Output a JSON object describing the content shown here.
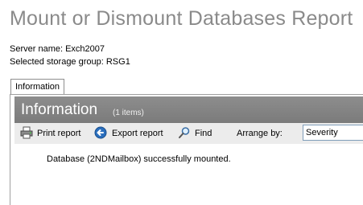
{
  "report": {
    "title": "Mount or Dismount Databases Report",
    "server_line": "Server name: Exch2007",
    "storage_group_line": "Selected storage group: RSG1"
  },
  "tabs": [
    {
      "label": "Information",
      "selected": true
    }
  ],
  "panel": {
    "title": "Information",
    "count": "(1 items)"
  },
  "toolbar": {
    "print_label": "Print report",
    "export_label": "Export report",
    "find_label": "Find",
    "arrange_label": "Arrange by:",
    "arrange_value": "Severity"
  },
  "icons": {
    "print": "printer-icon",
    "export": "export-arrow-icon",
    "find": "magnifier-icon"
  },
  "colors": {
    "title_gray": "#8a8a8a",
    "header_bg": "#858585",
    "export_blue": "#2a6ebd"
  },
  "results": [
    {
      "message": "Database (2NDMailbox) successfully mounted."
    }
  ]
}
